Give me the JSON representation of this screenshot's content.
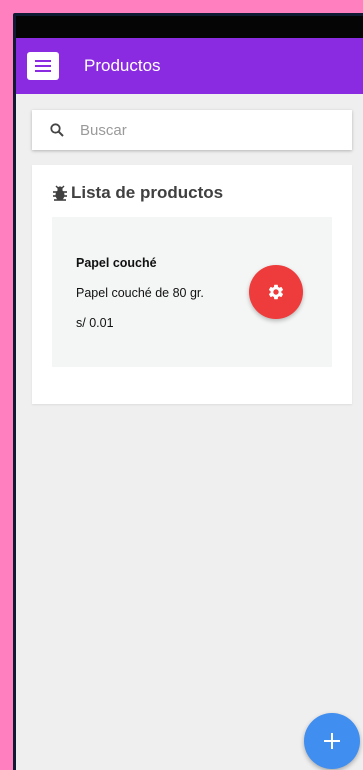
{
  "appbar": {
    "title": "Productos",
    "menu_icon": "menu-icon"
  },
  "search": {
    "placeholder": "Buscar",
    "value": "",
    "icon": "search-icon"
  },
  "list": {
    "title": "Lista de productos",
    "icon": "bug-icon",
    "items": [
      {
        "name": "Papel couché",
        "description": "Papel couché de 80 gr.",
        "price": "s/ 0.01",
        "action_icon": "gear-icon"
      }
    ]
  },
  "fab": {
    "icon": "plus-icon"
  },
  "colors": {
    "background": "#ff7fbf",
    "appbar": "#8a2be2",
    "action_red": "#ee3b3b",
    "fab_blue": "#3f8ef0"
  }
}
